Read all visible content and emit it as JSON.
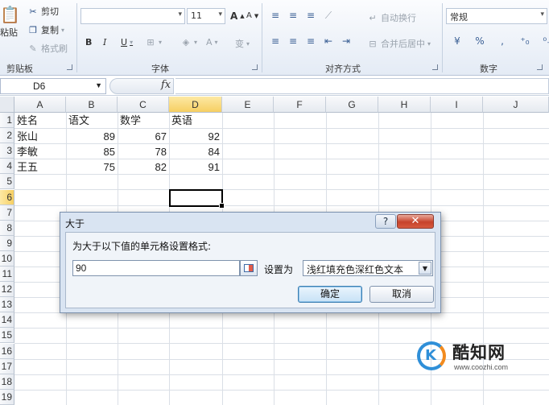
{
  "ribbon": {
    "clipboard": {
      "paste": "粘贴",
      "cut": "剪切",
      "copy": "复制",
      "format_painter": "格式刷",
      "group": "剪贴板"
    },
    "font": {
      "size": "11",
      "grow": "A",
      "shrink": "A",
      "bold": "B",
      "italic": "I",
      "underline": "U",
      "font_color": "A",
      "phonetic": "变",
      "group": "字体"
    },
    "alignment": {
      "wrap_text": "自动换行",
      "merge_center": "合并后居中",
      "group": "对齐方式"
    },
    "number": {
      "format": "常规",
      "currency": "¥",
      "percent": "%",
      "comma": ",",
      "group": "数字"
    }
  },
  "formula_bar": {
    "name_box": "D6",
    "fx": "fx",
    "formula": ""
  },
  "columns": [
    "A",
    "B",
    "C",
    "D",
    "E",
    "F",
    "G",
    "H",
    "I",
    "J"
  ],
  "selected_column": "D",
  "rows": [
    "1",
    "2",
    "3",
    "4",
    "5",
    "6",
    "7",
    "8",
    "9",
    "10",
    "11",
    "12",
    "13",
    "14",
    "15",
    "16",
    "17",
    "18",
    "19"
  ],
  "selected_row": "6",
  "table": {
    "header": [
      "姓名",
      "语文",
      "数学",
      "英语"
    ],
    "data": [
      [
        "张山",
        "89",
        "67",
        "92"
      ],
      [
        "李敏",
        "85",
        "78",
        "84"
      ],
      [
        "王五",
        "75",
        "82",
        "91"
      ]
    ]
  },
  "dialog": {
    "title": "大于",
    "help": "?",
    "close": "✕",
    "prompt": "为大于以下值的单元格设置格式:",
    "value": "90",
    "set_label": "设置为",
    "format_option": "浅红填充色深红色文本",
    "ok": "确定",
    "cancel": "取消"
  },
  "watermark": {
    "name": "酷知网",
    "url": "www.coozhi.com",
    "logo_letter": "K"
  }
}
